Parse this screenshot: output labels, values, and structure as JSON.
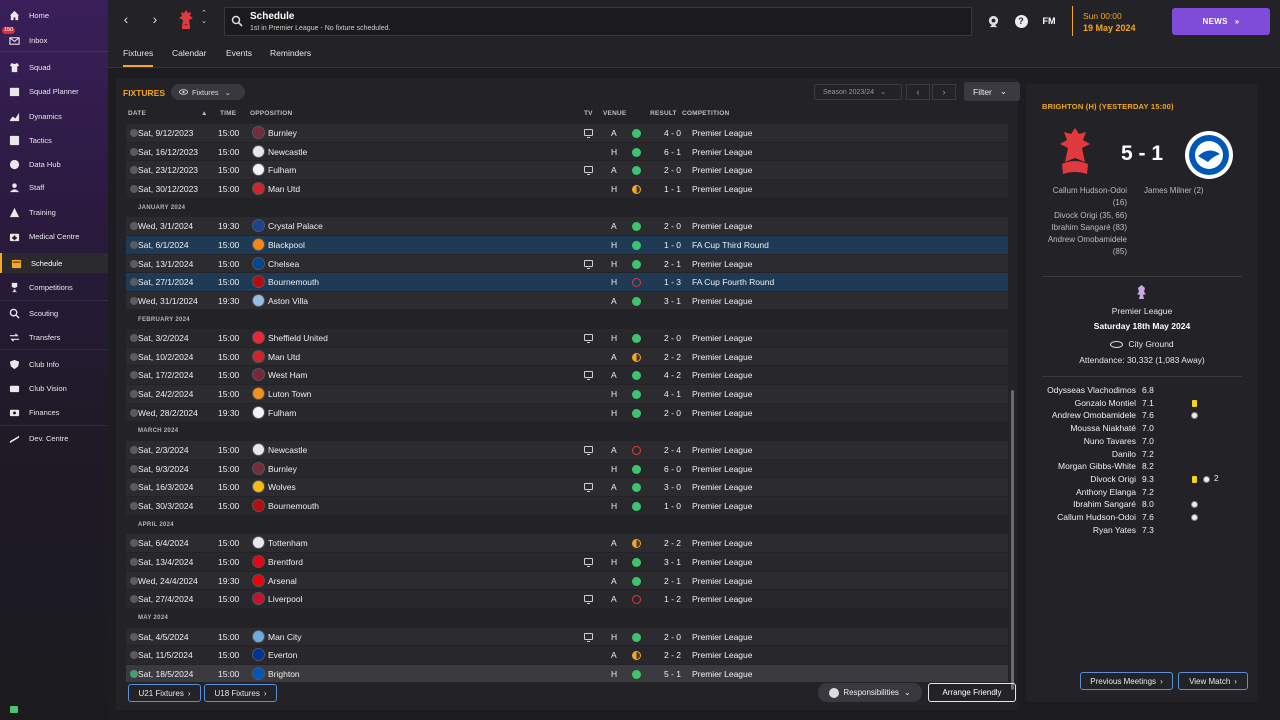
{
  "sidebar": {
    "inbox_badge": "150",
    "items": [
      {
        "label": "Home",
        "icon": "home-icon"
      },
      {
        "label": "Inbox",
        "icon": "inbox-icon"
      },
      {
        "label": "Squad",
        "icon": "shirt-icon"
      },
      {
        "label": "Squad Planner",
        "icon": "planner-icon"
      },
      {
        "label": "Dynamics",
        "icon": "dynamics-icon"
      },
      {
        "label": "Tactics",
        "icon": "tactics-icon"
      },
      {
        "label": "Data Hub",
        "icon": "data-hub-icon"
      },
      {
        "label": "Staff",
        "icon": "staff-icon"
      },
      {
        "label": "Training",
        "icon": "training-icon"
      },
      {
        "label": "Medical Centre",
        "icon": "medical-icon"
      },
      {
        "label": "Schedule",
        "icon": "calendar-icon"
      },
      {
        "label": "Competitions",
        "icon": "trophy-icon"
      },
      {
        "label": "Scouting",
        "icon": "scouting-icon"
      },
      {
        "label": "Transfers",
        "icon": "transfers-icon"
      },
      {
        "label": "Club Info",
        "icon": "shield-icon"
      },
      {
        "label": "Club Vision",
        "icon": "vision-icon"
      },
      {
        "label": "Finances",
        "icon": "finances-icon"
      },
      {
        "label": "Dev. Centre",
        "icon": "dev-centre-icon"
      }
    ]
  },
  "header": {
    "title": "Schedule",
    "subtitle": "1st in Premier League - No fixture scheduled.",
    "fm_label": "FM",
    "time": "Sun 00:00",
    "date": "19 May 2024",
    "news_label": "NEWS"
  },
  "subtabs": [
    "Fixtures",
    "Calendar",
    "Events",
    "Reminders"
  ],
  "fixtures": {
    "section_label": "FIXTURES",
    "filter_dropdown": "Fixtures",
    "season": "Season 2023/24",
    "filter_label": "Filter",
    "columns": {
      "date": "DATE",
      "time": "TIME",
      "opposition": "OPPOSITION",
      "tv": "TV",
      "venue": "VENUE",
      "result": "RESULT",
      "competition": "COMPETITION"
    },
    "months": {
      "jan": "JANUARY 2024",
      "feb": "FEBRUARY 2024",
      "mar": "MARCH 2024",
      "apr": "APRIL 2024",
      "may": "MAY 2024"
    },
    "rows": [
      {
        "date": "Sat, 9/12/2023",
        "time": "15:00",
        "opp": "Burnley",
        "tv": true,
        "venue": "A",
        "res": "win",
        "score": "4 - 0",
        "comp": "Premier League",
        "crest": "#7a2a3d"
      },
      {
        "date": "Sat, 16/12/2023",
        "time": "15:00",
        "opp": "Newcastle",
        "tv": false,
        "venue": "H",
        "res": "win",
        "score": "6 - 1",
        "comp": "Premier League",
        "crest": "#e8e8e8"
      },
      {
        "date": "Sat, 23/12/2023",
        "time": "15:00",
        "opp": "Fulham",
        "tv": true,
        "venue": "A",
        "res": "win",
        "score": "2 - 0",
        "comp": "Premier League",
        "crest": "#f4f4f4"
      },
      {
        "date": "Sat, 30/12/2023",
        "time": "15:00",
        "opp": "Man Utd",
        "tv": false,
        "venue": "H",
        "res": "draw",
        "score": "1 - 1",
        "comp": "Premier League",
        "crest": "#d2232a"
      },
      {
        "date": "Wed, 3/1/2024",
        "time": "19:30",
        "opp": "Crystal Palace",
        "tv": false,
        "venue": "A",
        "res": "win",
        "score": "2 - 0",
        "comp": "Premier League",
        "crest": "#1b458f"
      },
      {
        "date": "Sat, 6/1/2024",
        "time": "15:00",
        "opp": "Blackpool",
        "tv": false,
        "venue": "H",
        "res": "win",
        "score": "1 - 0",
        "comp": "FA Cup Third Round",
        "crest": "#f68712"
      },
      {
        "date": "Sat, 13/1/2024",
        "time": "15:00",
        "opp": "Chelsea",
        "tv": true,
        "venue": "H",
        "res": "win",
        "score": "2 - 1",
        "comp": "Premier League",
        "crest": "#034694"
      },
      {
        "date": "Sat, 27/1/2024",
        "time": "15:00",
        "opp": "Bournemouth",
        "tv": false,
        "venue": "H",
        "res": "loss",
        "score": "1 - 3",
        "comp": "FA Cup Fourth Round",
        "crest": "#b50e12"
      },
      {
        "date": "Wed, 31/1/2024",
        "time": "19:30",
        "opp": "Aston Villa",
        "tv": false,
        "venue": "A",
        "res": "win",
        "score": "3 - 1",
        "comp": "Premier League",
        "crest": "#95bfe5"
      },
      {
        "date": "Sat, 3/2/2024",
        "time": "15:00",
        "opp": "Sheffield United",
        "tv": true,
        "venue": "H",
        "res": "win",
        "score": "2 - 0",
        "comp": "Premier League",
        "crest": "#ee2737"
      },
      {
        "date": "Sat, 10/2/2024",
        "time": "15:00",
        "opp": "Man Utd",
        "tv": false,
        "venue": "A",
        "res": "draw",
        "score": "2 - 2",
        "comp": "Premier League",
        "crest": "#d2232a"
      },
      {
        "date": "Sat, 17/2/2024",
        "time": "15:00",
        "opp": "West Ham",
        "tv": true,
        "venue": "A",
        "res": "win",
        "score": "4 - 2",
        "comp": "Premier League",
        "crest": "#7a263a"
      },
      {
        "date": "Sat, 24/2/2024",
        "time": "15:00",
        "opp": "Luton Town",
        "tv": false,
        "venue": "H",
        "res": "win",
        "score": "4 - 1",
        "comp": "Premier League",
        "crest": "#f78f1e"
      },
      {
        "date": "Wed, 28/2/2024",
        "time": "19:30",
        "opp": "Fulham",
        "tv": false,
        "venue": "H",
        "res": "win",
        "score": "2 - 0",
        "comp": "Premier League",
        "crest": "#f4f4f4"
      },
      {
        "date": "Sat, 2/3/2024",
        "time": "15:00",
        "opp": "Newcastle",
        "tv": true,
        "venue": "A",
        "res": "loss",
        "score": "2 - 4",
        "comp": "Premier League",
        "crest": "#e8e8e8"
      },
      {
        "date": "Sat, 9/3/2024",
        "time": "15:00",
        "opp": "Burnley",
        "tv": false,
        "venue": "H",
        "res": "win",
        "score": "6 - 0",
        "comp": "Premier League",
        "crest": "#7a2a3d"
      },
      {
        "date": "Sat, 16/3/2024",
        "time": "15:00",
        "opp": "Wolves",
        "tv": true,
        "venue": "A",
        "res": "win",
        "score": "3 - 0",
        "comp": "Premier League",
        "crest": "#fdb913"
      },
      {
        "date": "Sat, 30/3/2024",
        "time": "15:00",
        "opp": "Bournemouth",
        "tv": false,
        "venue": "H",
        "res": "win",
        "score": "1 - 0",
        "comp": "Premier League",
        "crest": "#b50e12"
      },
      {
        "date": "Sat, 6/4/2024",
        "time": "15:00",
        "opp": "Tottenham",
        "tv": false,
        "venue": "A",
        "res": "draw",
        "score": "2 - 2",
        "comp": "Premier League",
        "crest": "#e8e8f0"
      },
      {
        "date": "Sat, 13/4/2024",
        "time": "15:00",
        "opp": "Brentford",
        "tv": true,
        "venue": "H",
        "res": "win",
        "score": "3 - 1",
        "comp": "Premier League",
        "crest": "#e30613"
      },
      {
        "date": "Wed, 24/4/2024",
        "time": "19:30",
        "opp": "Arsenal",
        "tv": false,
        "venue": "A",
        "res": "win",
        "score": "2 - 1",
        "comp": "Premier League",
        "crest": "#ef0107"
      },
      {
        "date": "Sat, 27/4/2024",
        "time": "15:00",
        "opp": "Liverpool",
        "tv": true,
        "venue": "A",
        "res": "loss",
        "score": "1 - 2",
        "comp": "Premier League",
        "crest": "#c8102e"
      },
      {
        "date": "Sat, 4/5/2024",
        "time": "15:00",
        "opp": "Man City",
        "tv": true,
        "venue": "H",
        "res": "win",
        "score": "2 - 0",
        "comp": "Premier League",
        "crest": "#6cabdd"
      },
      {
        "date": "Sat, 11/5/2024",
        "time": "15:00",
        "opp": "Everton",
        "tv": false,
        "venue": "A",
        "res": "draw",
        "score": "2 - 2",
        "comp": "Premier League",
        "crest": "#003399"
      },
      {
        "date": "Sat, 18/5/2024",
        "time": "15:00",
        "opp": "Brighton",
        "tv": false,
        "venue": "H",
        "res": "win",
        "score": "5 - 1",
        "comp": "Premier League",
        "crest": "#0057b8"
      }
    ],
    "u21_label": "U21 Fixtures",
    "u18_label": "U18 Fixtures",
    "responsibilities_label": "Responsibilities",
    "arrange_label": "Arrange Friendly"
  },
  "match": {
    "heading": "BRIGHTON (H) (YESTERDAY 15:00)",
    "score": "5 - 1",
    "home_scorers": [
      "Callum Hudson-Odoi",
      "(16)",
      "Divock Origi (35, 66)",
      "Ibrahim Sangaré (83)",
      "Andrew Omobamidele",
      "(85)"
    ],
    "away_scorers": [
      "James Milner (2)"
    ],
    "competition": "Premier League",
    "date": "Saturday 18th May 2024",
    "stadium": "City Ground",
    "attendance": "Attendance: 30,332 (1,083 Away)",
    "players": [
      {
        "name": "Odysseas Vlachodimos",
        "rating": "6.8"
      },
      {
        "name": "Gonzalo Montiel",
        "rating": "7.1"
      },
      {
        "name": "Andrew Omobamidele",
        "rating": "7.6"
      },
      {
        "name": "Moussa Niakhaté",
        "rating": "7.0"
      },
      {
        "name": "Nuno Tavares",
        "rating": "7.0"
      },
      {
        "name": "Danilo",
        "rating": "7.2"
      },
      {
        "name": "Morgan Gibbs-White",
        "rating": "8.2"
      },
      {
        "name": "Divock Origi",
        "rating": "9.3"
      },
      {
        "name": "Anthony Elanga",
        "rating": "7.2"
      },
      {
        "name": "Ibrahim Sangaré",
        "rating": "8.0"
      },
      {
        "name": "Callum Hudson-Odoi",
        "rating": "7.6"
      },
      {
        "name": "Ryan Yates",
        "rating": "7.3"
      }
    ],
    "origi_goals": "2",
    "prev_meetings_label": "Previous Meetings",
    "view_match_label": "View Match"
  }
}
